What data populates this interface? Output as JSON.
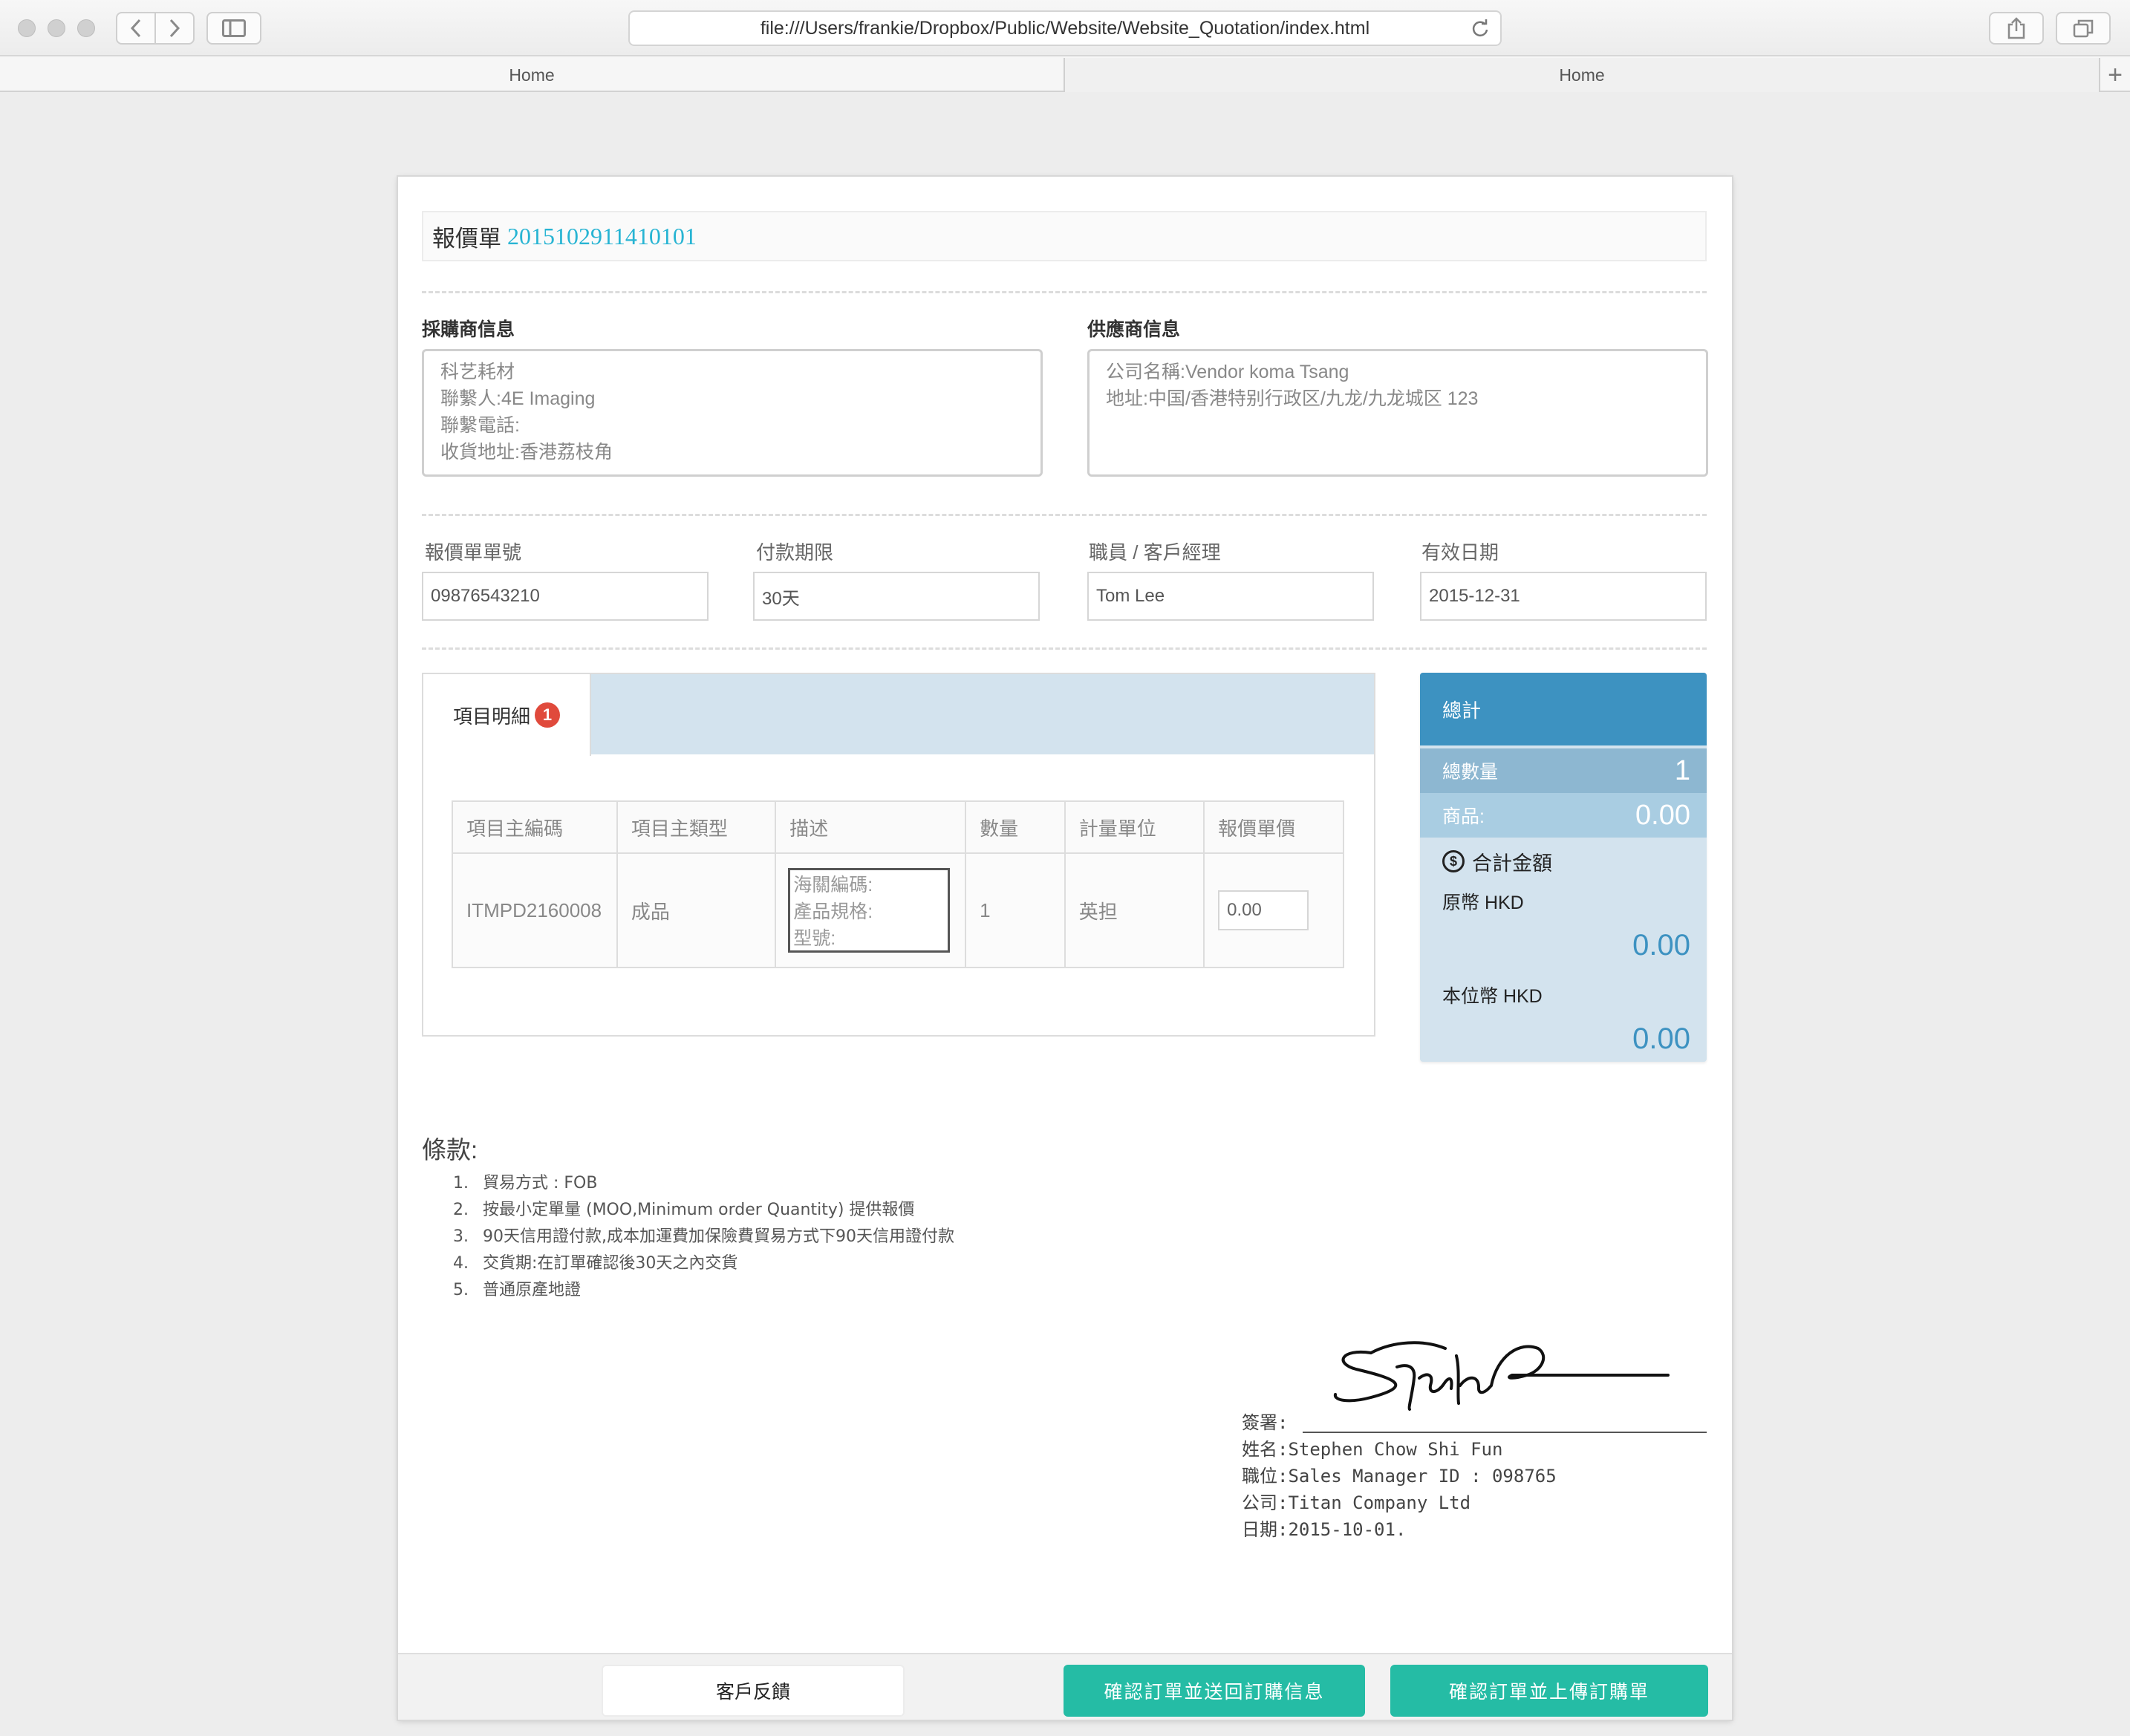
{
  "browser": {
    "url": "file:///Users/frankie/Dropbox/Public/Website/Website_Quotation/index.html",
    "tabs": [
      {
        "label": "Home"
      },
      {
        "label": "Home"
      }
    ],
    "new_tab_label": "+"
  },
  "quotation": {
    "title_label": "報價單",
    "number": "2015102911410101"
  },
  "buyer": {
    "heading": "採購商信息",
    "lines": [
      "科艺耗材",
      "聯繫人:4E Imaging",
      "聯繫電話:",
      "收貨地址:香港荔枝角"
    ]
  },
  "supplier": {
    "heading": "供應商信息",
    "lines": [
      "公司名稱:Vendor koma Tsang",
      "地址:中国/香港特别行政区/九龙/九龙城区 123"
    ]
  },
  "fields": [
    {
      "label": "報價單單號",
      "value": "09876543210"
    },
    {
      "label": "付款期限",
      "value": "30天"
    },
    {
      "label": "職員 / 客戶經理",
      "value": "Tom Lee"
    },
    {
      "label": "有效日期",
      "value": "2015-12-31"
    }
  ],
  "items": {
    "tab_label": "項目明細",
    "badge": "1",
    "columns": [
      "項目主編碼",
      "項目主類型",
      "描述",
      "數量",
      "計量單位",
      "報價單價"
    ],
    "rows": [
      {
        "code": "ITMPD2160008",
        "type": "成品",
        "description": [
          "海關編碼:",
          "產品規格:",
          "型號:"
        ],
        "quantity": "1",
        "unit": "英担",
        "price": "0.00"
      }
    ]
  },
  "totals": {
    "heading": "總計",
    "quantity_label": "總數量",
    "quantity_value": "1",
    "goods_label": "商品:",
    "goods_value": "0.00",
    "grand_label": "合計金額",
    "grand_icon": "dollar-coin-icon",
    "original_label": "原幣 HKD",
    "original_value": "0.00",
    "local_label": "本位幣 HKD",
    "local_value": "0.00"
  },
  "terms": {
    "title": "條款:",
    "items": [
      {
        "n": "1.",
        "text": "貿易方式 : FOB"
      },
      {
        "n": "2.",
        "text": "按最小定單量 (MOO,Minimum order Quantity) 提供報價"
      },
      {
        "n": "3.",
        "text": "90天信用證付款,成本加運費加保險費貿易方式下90天信用證付款"
      },
      {
        "n": "4.",
        "text": "交貨期:在訂單確認後30天之內交貨"
      },
      {
        "n": "5.",
        "text": "普通原產地證"
      }
    ]
  },
  "signature": {
    "sign_label": "簽署:",
    "name": "姓名:Stephen Chow Shi Fun",
    "position": "職位:Sales Manager ID : 098765",
    "company": "公司:Titan Company Ltd",
    "date": "日期:2015-10-01."
  },
  "footer": {
    "feedback_button": "客戶反饋",
    "confirm_return_button": "確認訂單並送回訂購信息",
    "confirm_upload_button": "確認訂單並上傳訂購單"
  },
  "colors": {
    "accent_cyan": "#27b4d3",
    "totals_header": "#3d92c1",
    "teal_button": "#25bca5",
    "badge_red": "#e04a3c"
  }
}
